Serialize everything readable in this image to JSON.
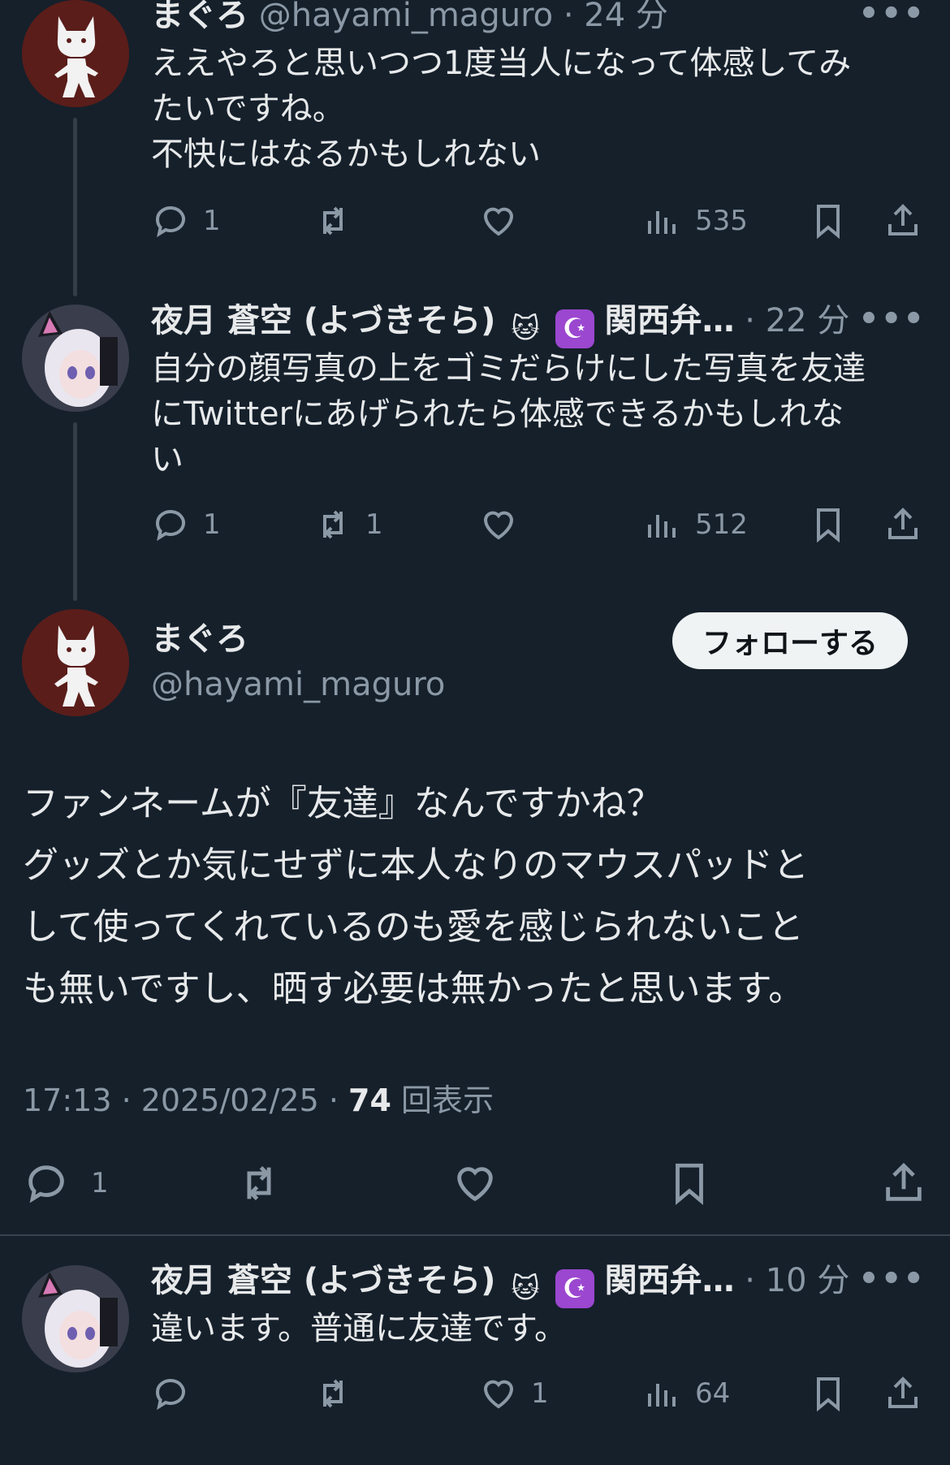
{
  "colors": {
    "background": "#15202b",
    "text": "#e7e9ea",
    "muted": "#8b98a5",
    "follow_bg": "#eff3f4"
  },
  "tweets": [
    {
      "name": "まぐろ",
      "handle": "@hayami_maguro",
      "sep": "·",
      "time": "24 分",
      "more": "•••",
      "text": "ええやろと思いつつ1度当人になって体感してみ\nたいですね。\n不快にはなるかもしれない",
      "reply_count": "1",
      "retweet_count": "",
      "like_count": "",
      "views": "535"
    },
    {
      "name": "夜月 蒼空 (よづきそら)",
      "badge_cat": "🐱",
      "badge_moon": "☪",
      "name_suffix": "関西弁…",
      "sep": "·",
      "time": "22 分",
      "more": "•••",
      "text": "自分の顔写真の上をゴミだらけにした写真を友達\nにTwitterにあげられたら体感できるかもしれな\nい",
      "reply_count": "1",
      "retweet_count": "1",
      "like_count": "",
      "views": "512"
    }
  ],
  "main_tweet": {
    "name": "まぐろ",
    "handle": "@hayami_maguro",
    "follow_label": "フォローする",
    "text": "ファンネームが『友達』なんですかね？\nグッズとか気にせずに本人なりのマウスパッドと\nして使ってくれているのも愛を感じられないこと\nも無いですし、晒す必要は無かったと思います。",
    "time": "17:13 · 2025/02/25 · ",
    "views_count": "74",
    "views_label": " 回表示",
    "reply_count": "1"
  },
  "reply": {
    "name": "夜月 蒼空 (よづきそら)",
    "badge_cat": "🐱",
    "badge_moon": "☪",
    "name_suffix": "関西弁…",
    "sep": "·",
    "time": "10 分",
    "more": "•••",
    "text": "違います。普通に友達です。",
    "reply_count": "",
    "like_count": "1",
    "views": "64"
  }
}
